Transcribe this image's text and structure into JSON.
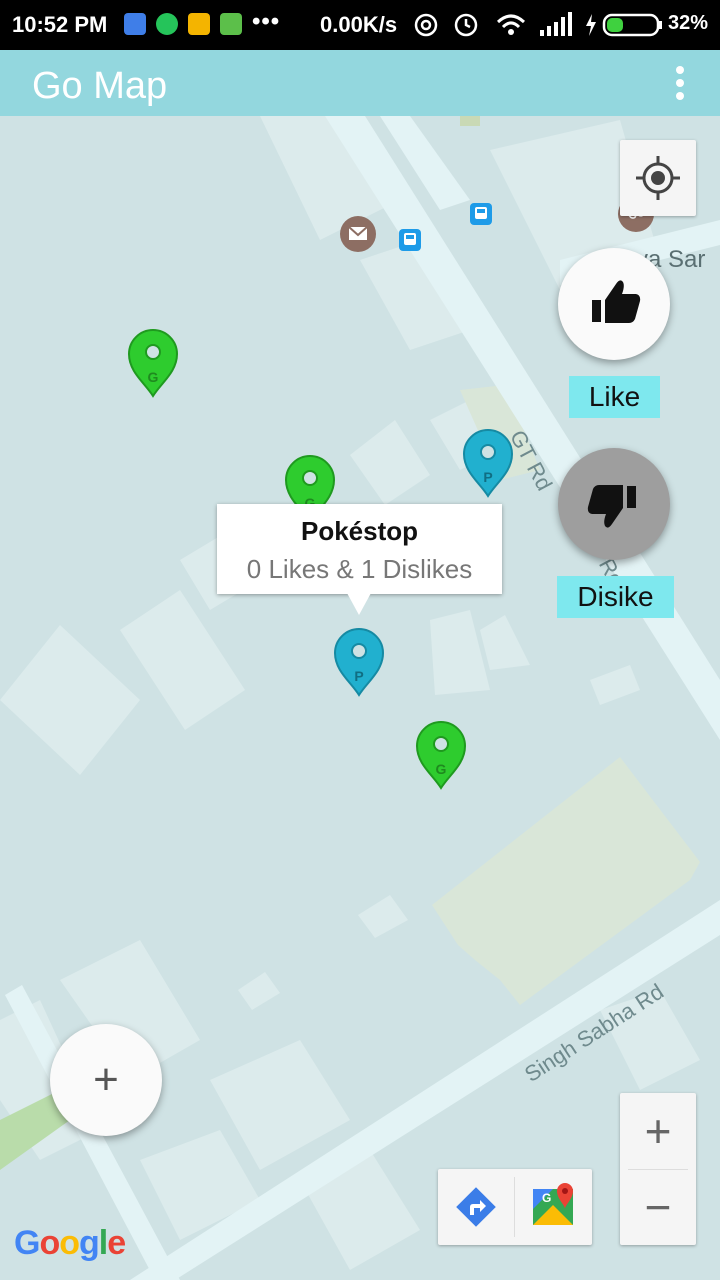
{
  "status_bar": {
    "time": "10:52 PM",
    "more_icons": "•••",
    "net_speed": "0.00K/s",
    "battery_percent": "32%"
  },
  "app_bar": {
    "title": "Go Map",
    "menu_icon": "more-vert-icon"
  },
  "map": {
    "road_labels": [
      "GT Rd",
      "Singh Sabha Rd",
      "rva Sar",
      "Rd"
    ],
    "markers": [
      {
        "type": "gym",
        "letter": "G",
        "color": "#2ecc2e"
      },
      {
        "type": "gym",
        "letter": "G",
        "color": "#2ecc2e"
      },
      {
        "type": "gym",
        "letter": "G",
        "color": "#2ecc2e"
      },
      {
        "type": "pokestop",
        "letter": "P",
        "color": "#21b0cf"
      },
      {
        "type": "pokestop",
        "letter": "P",
        "color": "#21b0cf"
      }
    ],
    "poi_icons": [
      "mail-icon",
      "bus-stop-icon",
      "bus-stop-icon",
      "om-temple-icon"
    ]
  },
  "popup": {
    "title": "Pokéstop",
    "subtitle": "0 Likes & 1 Dislikes"
  },
  "actions": {
    "like_label": "Like",
    "dislike_label": "Disike",
    "add_symbol": "+",
    "zoom_in": "+",
    "zoom_out": "−"
  },
  "attribution": {
    "logo_letters": [
      "G",
      "o",
      "o",
      "g",
      "l",
      "e"
    ]
  },
  "colors": {
    "app_bar": "#93d7de",
    "tag": "#7ee8ee",
    "map_bg": "#cfe2e4",
    "road": "#e3f3f5",
    "block": "#dcebec",
    "park": "#d9e6d8"
  }
}
